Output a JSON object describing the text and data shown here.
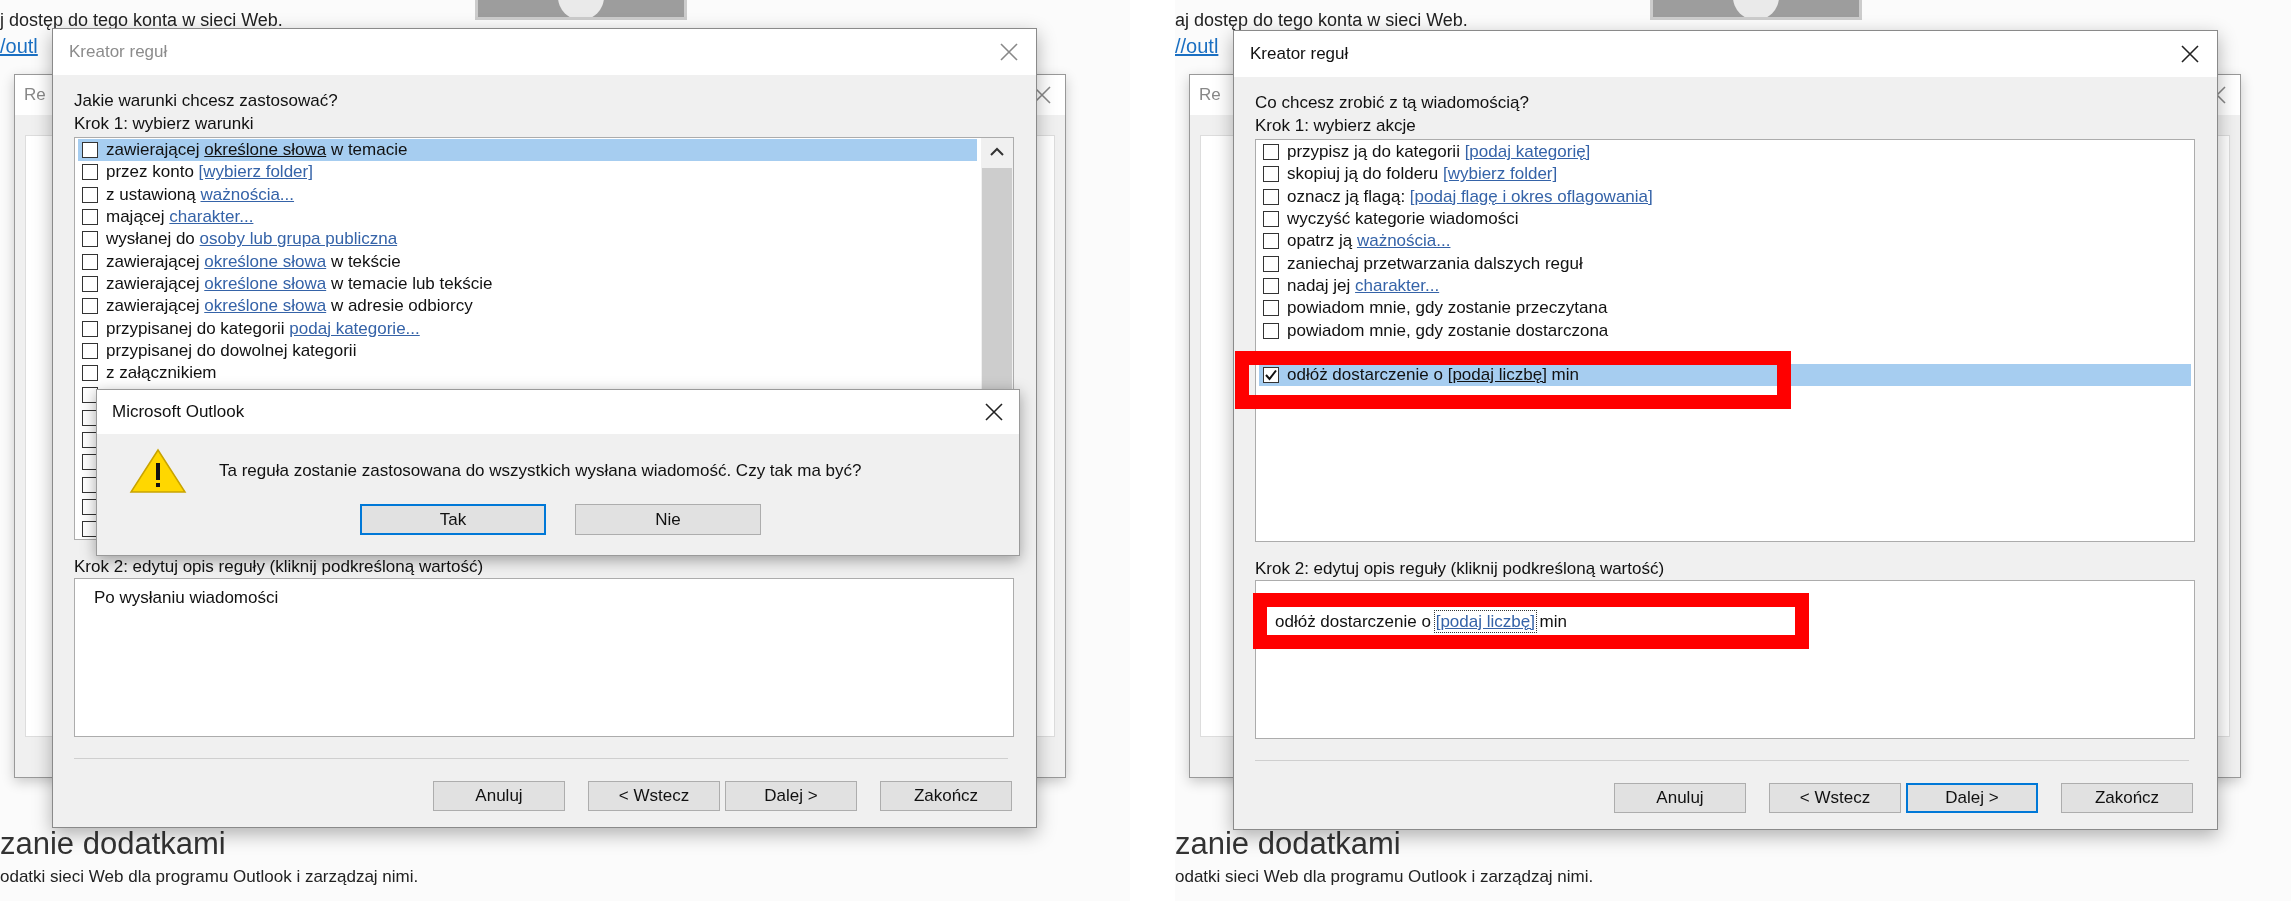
{
  "screens": [
    {
      "background": {
        "intro": "j dostęp do tego konta w sieci Web.",
        "link": "/outl",
        "heading": "zanie dodatkami",
        "text": "odatki sieci Web dla programu Outlook i zarządzaj nimi."
      },
      "back_window": {
        "title": "Re"
      },
      "wizard": {
        "title": "Kreator reguł",
        "title_active": false,
        "question": "Jakie warunki chcesz zastosować?",
        "step1": "Krok 1: wybierz warunki",
        "items": [
          {
            "checked": false,
            "selected": true,
            "parts": [
              {
                "text": "zawierającej "
              },
              {
                "text": "określone słowa",
                "link": true
              },
              {
                "text": " w temacie"
              }
            ]
          },
          {
            "checked": false,
            "selected": false,
            "parts": [
              {
                "text": "przez konto "
              },
              {
                "text": "[wybierz folder]",
                "link": true
              }
            ]
          },
          {
            "checked": false,
            "selected": false,
            "parts": [
              {
                "text": "z ustawioną "
              },
              {
                "text": "ważnościa...",
                "link": true
              }
            ]
          },
          {
            "checked": false,
            "selected": false,
            "parts": [
              {
                "text": "mającej "
              },
              {
                "text": "charakter...",
                "link": true
              }
            ]
          },
          {
            "checked": false,
            "selected": false,
            "parts": [
              {
                "text": "wysłanej do "
              },
              {
                "text": "osoby lub grupa publiczna",
                "link": true
              }
            ]
          },
          {
            "checked": false,
            "selected": false,
            "parts": [
              {
                "text": "zawierającej "
              },
              {
                "text": "określone słowa",
                "link": true
              },
              {
                "text": " w tekście"
              }
            ]
          },
          {
            "checked": false,
            "selected": false,
            "parts": [
              {
                "text": "zawierającej "
              },
              {
                "text": "określone słowa",
                "link": true
              },
              {
                "text": " w temacie lub tekście"
              }
            ]
          },
          {
            "checked": false,
            "selected": false,
            "parts": [
              {
                "text": "zawierającej "
              },
              {
                "text": "określone słowa",
                "link": true
              },
              {
                "text": " w adresie odbiorcy"
              }
            ]
          },
          {
            "checked": false,
            "selected": false,
            "parts": [
              {
                "text": "przypisanej do kategorii "
              },
              {
                "text": "podaj kategorie...",
                "link": true
              }
            ]
          },
          {
            "checked": false,
            "selected": false,
            "parts": [
              {
                "text": "przypisanej do dowolnej kategorii"
              }
            ]
          },
          {
            "checked": false,
            "selected": false,
            "parts": [
              {
                "text": "z załącznikiem"
              }
            ]
          },
          {
            "checked": false,
            "selected": false
          },
          {
            "checked": false,
            "selected": false
          },
          {
            "checked": false,
            "selected": false
          },
          {
            "checked": false,
            "selected": false
          },
          {
            "checked": false,
            "selected": false
          },
          {
            "checked": false,
            "selected": false
          },
          {
            "checked": false,
            "selected": false
          }
        ],
        "step2": "Krok 2: edytuj opis reguły (kliknij podkreśloną wartość)",
        "description": [
          {
            "highlighted": false,
            "parts": [
              {
                "text": "Po wysłaniu wiadomości"
              }
            ]
          }
        ],
        "buttons": [
          {
            "label": "Anuluj",
            "focused": false
          },
          {
            "label": "< Wstecz",
            "focused": false
          },
          {
            "label": "Dalej >",
            "focused": false
          },
          {
            "label": "Zakończ",
            "focused": false
          }
        ]
      },
      "message_box": {
        "title": "Microsoft Outlook",
        "text": "Ta reguła zostanie zastosowana do wszystkich wysłana wiadomość. Czy tak ma być?",
        "buttons": [
          {
            "label": "Tak",
            "focused": true
          },
          {
            "label": "Nie",
            "focused": false
          }
        ]
      }
    },
    {
      "background": {
        "intro": "aj dostęp do tego konta w sieci Web.",
        "link": "//outl",
        "heading": "zanie dodatkami",
        "text": "odatki sieci Web dla programu Outlook i zarządzaj nimi."
      },
      "back_window": {
        "title": "Re"
      },
      "wizard": {
        "title": "Kreator reguł",
        "title_active": true,
        "question": "Co chcesz zrobić z tą wiadomością?",
        "step1": "Krok 1: wybierz akcje",
        "items": [
          {
            "checked": false,
            "selected": false,
            "parts": [
              {
                "text": "przypisz ją do kategorii "
              },
              {
                "text": "[podaj kategorię]",
                "link": true
              }
            ]
          },
          {
            "checked": false,
            "selected": false,
            "parts": [
              {
                "text": "skopiuj ją do folderu "
              },
              {
                "text": "[wybierz folder]",
                "link": true
              }
            ]
          },
          {
            "checked": false,
            "selected": false,
            "parts": [
              {
                "text": "oznacz ją flagą: "
              },
              {
                "text": "[podaj flagę i okres oflagowania]",
                "link": true
              }
            ]
          },
          {
            "checked": false,
            "selected": false,
            "parts": [
              {
                "text": "wyczyść kategorie wiadomości"
              }
            ]
          },
          {
            "checked": false,
            "selected": false,
            "parts": [
              {
                "text": "opatrz ją "
              },
              {
                "text": "ważnościa...",
                "link": true
              }
            ]
          },
          {
            "checked": false,
            "selected": false,
            "parts": [
              {
                "text": "zaniechaj przetwarzania dalszych reguł"
              }
            ]
          },
          {
            "checked": false,
            "selected": false,
            "parts": [
              {
                "text": "nadaj jej "
              },
              {
                "text": "charakter...",
                "link": true
              }
            ]
          },
          {
            "checked": false,
            "selected": false,
            "parts": [
              {
                "text": "powiadom mnie, gdy zostanie przeczytana"
              }
            ]
          },
          {
            "checked": false,
            "selected": false,
            "parts": [
              {
                "text": "powiadom mnie, gdy zostanie dostarczona"
              }
            ]
          },
          {
            "checked": true,
            "selected": true,
            "highlighted": true,
            "parts": [
              {
                "text": "odłóż dostarczenie o "
              },
              {
                "text": "[podaj liczbę]",
                "link": true
              },
              {
                "text": " min"
              }
            ]
          }
        ],
        "step2": "Krok 2: edytuj opis reguły (kliknij podkreśloną wartość)",
        "description": [
          {
            "highlighted": true,
            "parts": [
              {
                "text": "odłóż dostarczenie o "
              },
              {
                "text": "[podaj liczbę]",
                "link": true,
                "focused": true
              },
              {
                "text": " min"
              }
            ]
          }
        ],
        "buttons": [
          {
            "label": "Anuluj",
            "focused": false
          },
          {
            "label": "< Wstecz",
            "focused": false
          },
          {
            "label": "Dalej >",
            "focused": true
          },
          {
            "label": "Zakończ",
            "focused": false
          }
        ]
      }
    }
  ]
}
